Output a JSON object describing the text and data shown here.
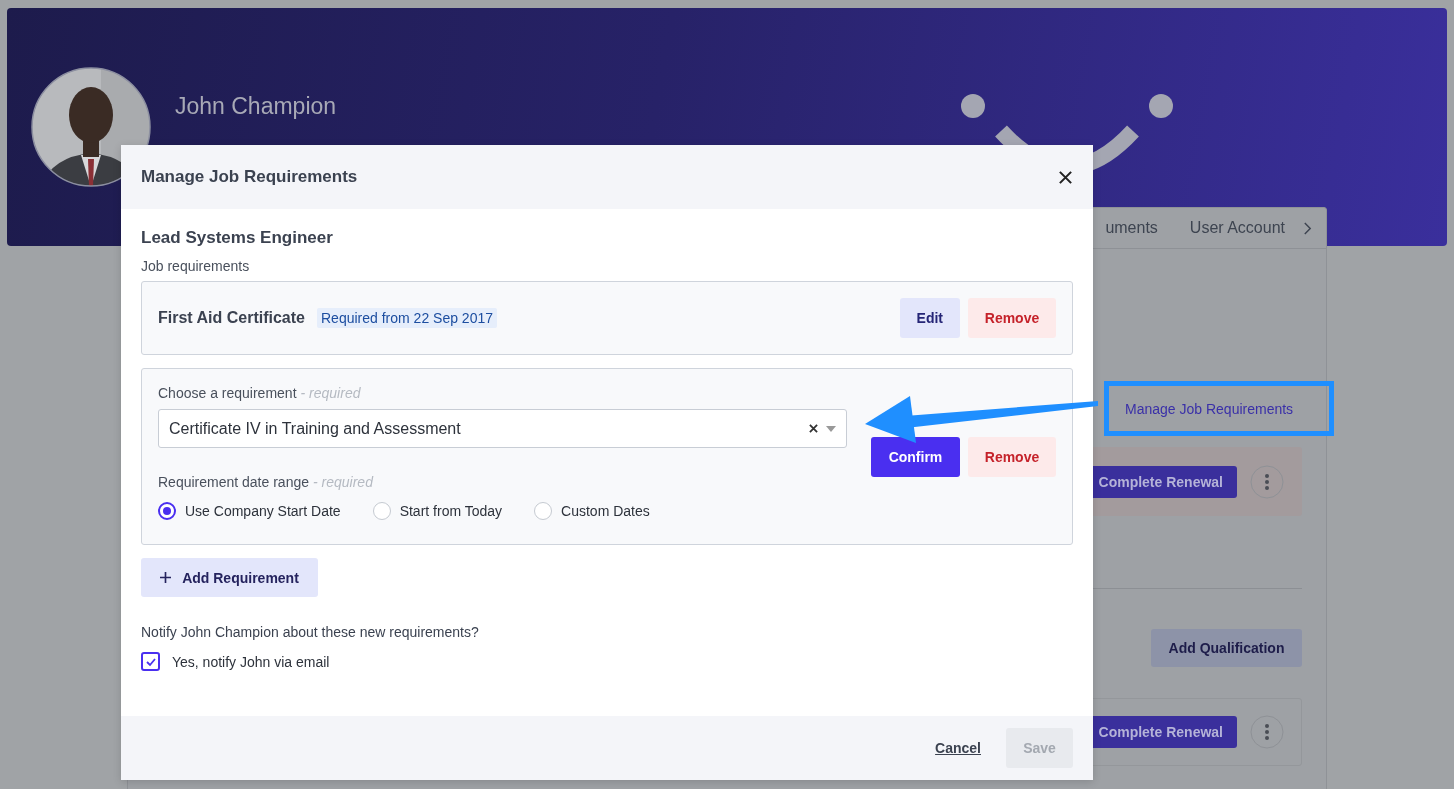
{
  "profile": {
    "name": "John Champion"
  },
  "tabs": [
    {
      "label": "uments"
    },
    {
      "label": "User Account"
    }
  ],
  "page": {
    "link": "Manage Job Requirements",
    "add_button": "Add Qualification",
    "rows": [
      {
        "action": "Complete Renewal",
        "highlighted": true
      },
      {
        "action": "Complete Renewal",
        "highlighted": false
      }
    ]
  },
  "modal": {
    "title": "Manage Job Requirements",
    "role": "Lead Systems Engineer",
    "section_label": "Job requirements",
    "requirements": [
      {
        "kind": "saved",
        "name": "First Aid Certificate",
        "tag": "Required from 22 Sep 2017",
        "buttons": [
          {
            "label": "Edit",
            "kind": "secondary"
          },
          {
            "label": "Remove",
            "kind": "danger"
          }
        ]
      },
      {
        "kind": "editing",
        "field_label": "Choose a requirement",
        "field_hint": "- required",
        "value": "Certificate IV in Training and Assessment",
        "date_label": "Requirement date range",
        "date_hint": "- required",
        "options": [
          {
            "label": "Use Company Start Date",
            "selected": true
          },
          {
            "label": "Start from Today",
            "selected": false
          },
          {
            "label": "Custom Dates",
            "selected": false
          }
        ],
        "buttons": [
          {
            "label": "Confirm",
            "kind": "primary"
          },
          {
            "label": "Remove",
            "kind": "danger"
          }
        ]
      }
    ],
    "add_button": "Add Requirement",
    "notify_question": "Notify John Champion about these new requirements?",
    "notify_checkbox": {
      "label": "Yes, notify John via email",
      "checked": true
    },
    "footer": {
      "cancel": "Cancel",
      "save": "Save",
      "save_disabled": true
    }
  }
}
